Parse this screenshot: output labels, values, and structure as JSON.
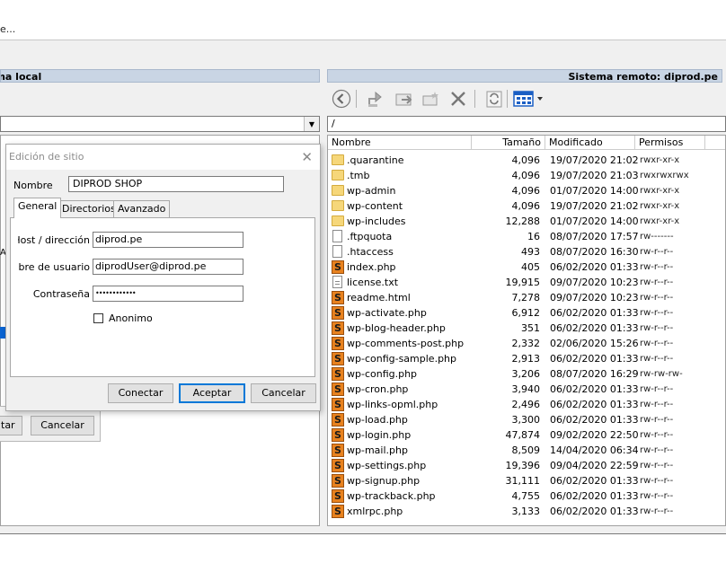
{
  "menu": {
    "text": "e..."
  },
  "local": {
    "header": "ema local",
    "side_label": "A",
    "dialog_fragment": {
      "left_button": "tar",
      "cancel_button": "Cancelar"
    }
  },
  "remote": {
    "header": "Sistema remoto: diprod.pe",
    "path": "/",
    "columns": {
      "name": "Nombre",
      "size": "Tamaño",
      "modified": "Modificado",
      "perms": "Permisos"
    },
    "toolbar_icons": [
      "back-icon",
      "upload-icon",
      "download-icon",
      "new-folder-icon",
      "delete-icon",
      "refresh-icon",
      "view-options-icon"
    ],
    "files": [
      {
        "type": "folder",
        "name": ".quarantine",
        "size": "4,096",
        "modified": "19/07/2020 21:02",
        "perms": "rwxr-xr-x"
      },
      {
        "type": "folder",
        "name": ".tmb",
        "size": "4,096",
        "modified": "19/07/2020 21:03",
        "perms": "rwxrwxrwx"
      },
      {
        "type": "folder",
        "name": "wp-admin",
        "size": "4,096",
        "modified": "01/07/2020 14:00",
        "perms": "rwxr-xr-x"
      },
      {
        "type": "folder",
        "name": "wp-content",
        "size": "4,096",
        "modified": "19/07/2020 21:02",
        "perms": "rwxr-xr-x"
      },
      {
        "type": "folder",
        "name": "wp-includes",
        "size": "12,288",
        "modified": "01/07/2020 14:00",
        "perms": "rwxr-xr-x"
      },
      {
        "type": "file",
        "name": ".ftpquota",
        "size": "16",
        "modified": "08/07/2020 17:57",
        "perms": "rw-------"
      },
      {
        "type": "file",
        "name": ".htaccess",
        "size": "493",
        "modified": "08/07/2020 16:30",
        "perms": "rw-r--r--"
      },
      {
        "type": "php",
        "name": "index.php",
        "size": "405",
        "modified": "06/02/2020 01:33",
        "perms": "rw-r--r--"
      },
      {
        "type": "txt",
        "name": "license.txt",
        "size": "19,915",
        "modified": "09/07/2020 10:23",
        "perms": "rw-r--r--"
      },
      {
        "type": "php",
        "name": "readme.html",
        "size": "7,278",
        "modified": "09/07/2020 10:23",
        "perms": "rw-r--r--"
      },
      {
        "type": "php",
        "name": "wp-activate.php",
        "size": "6,912",
        "modified": "06/02/2020 01:33",
        "perms": "rw-r--r--"
      },
      {
        "type": "php",
        "name": "wp-blog-header.php",
        "size": "351",
        "modified": "06/02/2020 01:33",
        "perms": "rw-r--r--"
      },
      {
        "type": "php",
        "name": "wp-comments-post.php",
        "size": "2,332",
        "modified": "02/06/2020 15:26",
        "perms": "rw-r--r--"
      },
      {
        "type": "php",
        "name": "wp-config-sample.php",
        "size": "2,913",
        "modified": "06/02/2020 01:33",
        "perms": "rw-r--r--"
      },
      {
        "type": "php",
        "name": "wp-config.php",
        "size": "3,206",
        "modified": "08/07/2020 16:29",
        "perms": "rw-rw-rw-"
      },
      {
        "type": "php",
        "name": "wp-cron.php",
        "size": "3,940",
        "modified": "06/02/2020 01:33",
        "perms": "rw-r--r--"
      },
      {
        "type": "php",
        "name": "wp-links-opml.php",
        "size": "2,496",
        "modified": "06/02/2020 01:33",
        "perms": "rw-r--r--"
      },
      {
        "type": "php",
        "name": "wp-load.php",
        "size": "3,300",
        "modified": "06/02/2020 01:33",
        "perms": "rw-r--r--"
      },
      {
        "type": "php",
        "name": "wp-login.php",
        "size": "47,874",
        "modified": "09/02/2020 22:50",
        "perms": "rw-r--r--"
      },
      {
        "type": "php",
        "name": "wp-mail.php",
        "size": "8,509",
        "modified": "14/04/2020 06:34",
        "perms": "rw-r--r--"
      },
      {
        "type": "php",
        "name": "wp-settings.php",
        "size": "19,396",
        "modified": "09/04/2020 22:59",
        "perms": "rw-r--r--"
      },
      {
        "type": "php",
        "name": "wp-signup.php",
        "size": "31,111",
        "modified": "06/02/2020 01:33",
        "perms": "rw-r--r--"
      },
      {
        "type": "php",
        "name": "wp-trackback.php",
        "size": "4,755",
        "modified": "06/02/2020 01:33",
        "perms": "rw-r--r--"
      },
      {
        "type": "php",
        "name": "xmlrpc.php",
        "size": "3,133",
        "modified": "06/02/2020 01:33",
        "perms": "rw-r--r--"
      }
    ]
  },
  "dialog": {
    "title": "Edición de sitio",
    "name_label": "Nombre",
    "name_value": "DIPROD SHOP",
    "tabs": [
      "General",
      "Directorios",
      "Avanzado"
    ],
    "host_label": "Host / dirección",
    "host_value": "diprod.pe",
    "user_label": "nbre de usuario",
    "user_value": "diprodUser@diprod.pe",
    "password_label": "Contraseña",
    "password_value": "••••••••••••",
    "anon_label": "Anonimo",
    "buttons": {
      "connect": "Conectar",
      "accept": "Aceptar",
      "cancel": "Cancelar"
    }
  },
  "colors": {
    "folder": "#f6d77a",
    "php_icon": "#e8821f",
    "selection": "#0a64d2",
    "header_bg": "#c9d5e4"
  }
}
